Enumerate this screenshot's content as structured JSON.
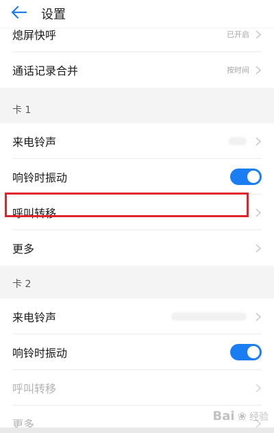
{
  "header": {
    "title": "设置",
    "back_icon": "arrow-left-icon",
    "accent": "#1a7ef2"
  },
  "rows_top": [
    {
      "label": "熄屏快呼",
      "value": "已开启"
    },
    {
      "label": "通话记录合并",
      "value": "按时间"
    }
  ],
  "card1": {
    "title": "卡 1",
    "items": [
      {
        "label": "来电铃声"
      },
      {
        "label": "响铃时振动",
        "toggle": true
      },
      {
        "label": "呼叫转移"
      },
      {
        "label": "更多"
      }
    ]
  },
  "card2": {
    "title": "卡 2",
    "items": [
      {
        "label": "来电铃声"
      },
      {
        "label": "响铃时振动",
        "toggle": true
      },
      {
        "label": "呼叫转移",
        "disabled": true
      },
      {
        "label": "更多",
        "disabled": true
      }
    ]
  },
  "colors": {
    "toggle_on": "#1a7ef2",
    "highlight": "#e0242b"
  },
  "watermark": {
    "text": "Bai",
    "suffix": "经验"
  }
}
